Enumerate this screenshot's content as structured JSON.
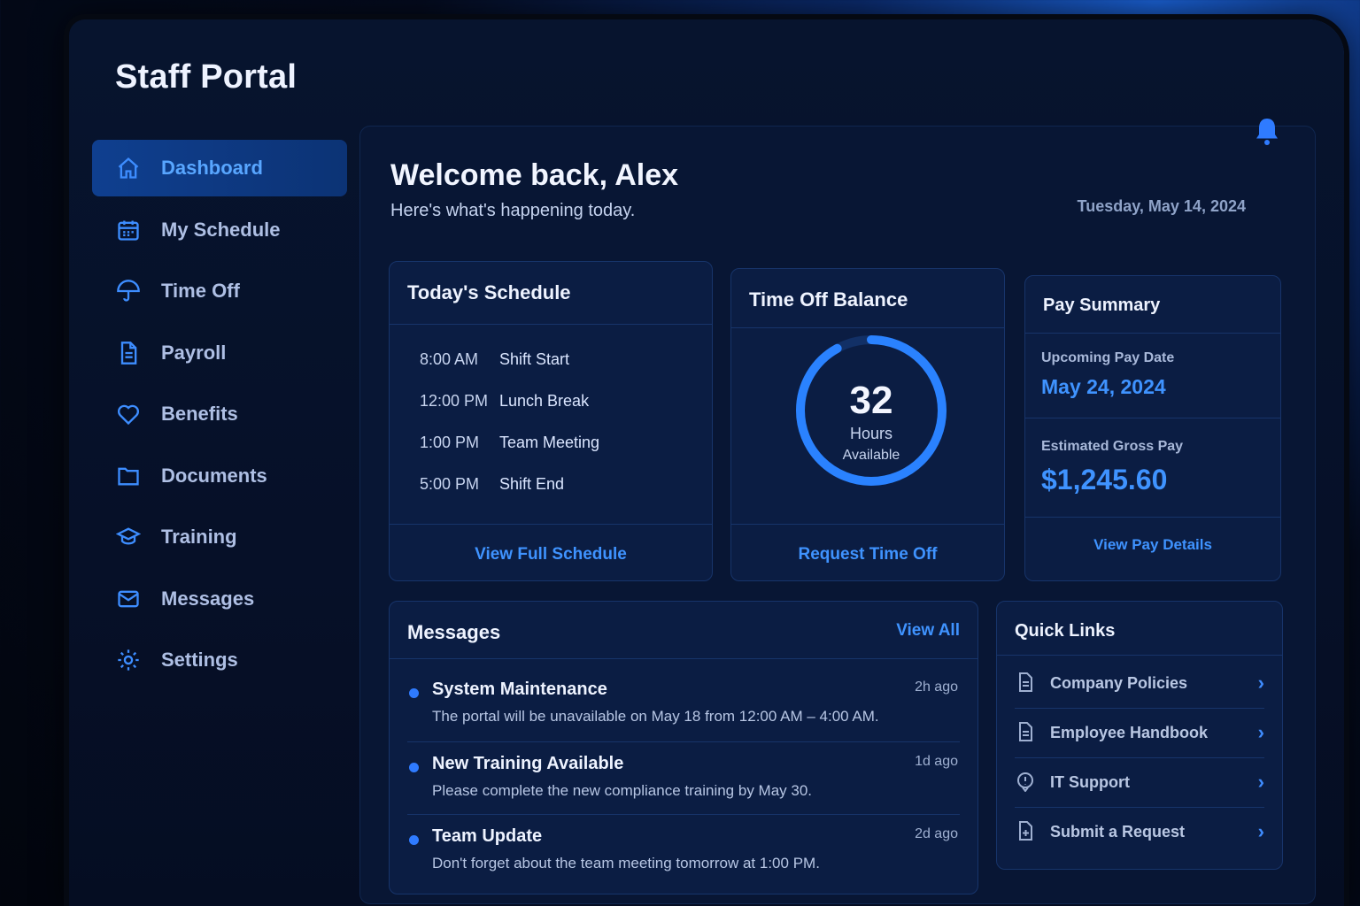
{
  "app": {
    "title": "Staff Portal"
  },
  "sidebar": {
    "items": [
      {
        "label": "Dashboard",
        "icon": "home-icon",
        "active": true
      },
      {
        "label": "My Schedule",
        "icon": "calendar-icon"
      },
      {
        "label": "Time Off",
        "icon": "umbrella-icon"
      },
      {
        "label": "Payroll",
        "icon": "document-icon"
      },
      {
        "label": "Benefits",
        "icon": "heart-icon"
      },
      {
        "label": "Documents",
        "icon": "folder-icon"
      },
      {
        "label": "Training",
        "icon": "graduation-cap-icon"
      },
      {
        "label": "Messages",
        "icon": "mail-icon"
      },
      {
        "label": "Settings",
        "icon": "gear-icon"
      }
    ]
  },
  "header": {
    "welcome": "Welcome back, Alex",
    "subtitle": "Here's what's happening today.",
    "date": "Tuesday, May 14, 2024"
  },
  "schedule": {
    "title": "Today's Schedule",
    "rows": [
      {
        "time": "8:00 AM",
        "event": "Shift Start"
      },
      {
        "time": "12:00 PM",
        "event": "Lunch Break"
      },
      {
        "time": "1:00 PM",
        "event": "Team Meeting"
      },
      {
        "time": "5:00 PM",
        "event": "Shift End"
      }
    ],
    "link": "View Full Schedule"
  },
  "time_off": {
    "title": "Time Off Balance",
    "hours": "32",
    "unit": "Hours",
    "sub": "Available",
    "ring_fraction": 0.92,
    "link": "Request Time Off"
  },
  "pay": {
    "title": "Pay Summary",
    "date_label": "Upcoming Pay Date",
    "date_value": "May 24, 2024",
    "gross_label": "Estimated Gross Pay",
    "gross_value": "$1,245.60",
    "link": "View Pay Details"
  },
  "messages": {
    "title": "Messages",
    "view_all": "View All",
    "items": [
      {
        "title": "System Maintenance",
        "body": "The portal will be unavailable on May 18 from 12:00 AM – 4:00 AM.",
        "time": "2h ago"
      },
      {
        "title": "New Training Available",
        "body": "Please complete the new compliance training by May 30.",
        "time": "1d ago"
      },
      {
        "title": "Team Update",
        "body": "Don't forget about the team meeting tomorrow at 1:00 PM.",
        "time": "2d ago"
      }
    ]
  },
  "quick_links": {
    "title": "Quick Links",
    "items": [
      {
        "label": "Company Policies",
        "icon": "document-icon"
      },
      {
        "label": "Employee Handbook",
        "icon": "document-icon"
      },
      {
        "label": "IT Support",
        "icon": "support-icon"
      },
      {
        "label": "Submit a Request",
        "icon": "request-icon"
      }
    ]
  },
  "colors": {
    "accent": "#3f93ff",
    "background": "#07142e",
    "card": "#0b1d43"
  }
}
